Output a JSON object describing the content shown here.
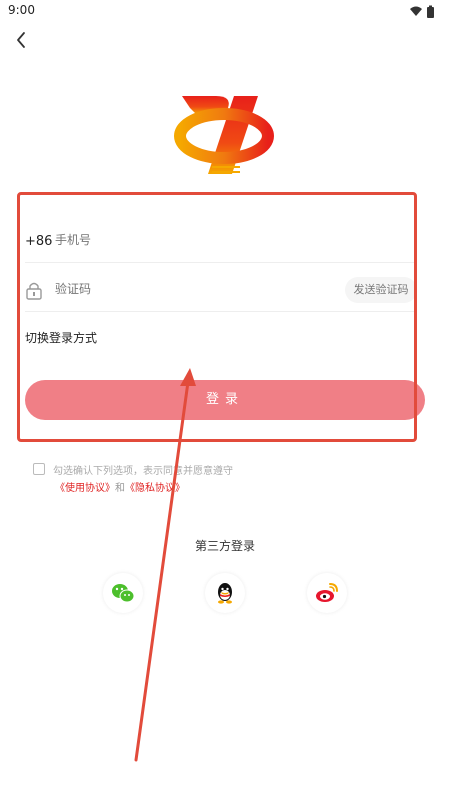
{
  "status": {
    "time": "9:00"
  },
  "login_form": {
    "phone_prefix": "+86",
    "phone_placeholder": "手机号",
    "code_placeholder": "验证码",
    "send_code_label": "发送验证码",
    "switch_method_label": "切换登录方式",
    "login_button_label": "登录"
  },
  "agreement": {
    "text": "勾选确认下列选项，表示同意并愿意遵守",
    "terms_link": "《使用协议》",
    "and_text": "和",
    "privacy_link": "《隐私协议》"
  },
  "third_party": {
    "title": "第三方登录",
    "providers": [
      "wechat-icon",
      "qq-icon",
      "weibo-icon"
    ]
  },
  "colors": {
    "login_button": "#f07f86",
    "link_red": "#e02424",
    "annotation_red": "#e24b3b",
    "logo_red": "#e8201a",
    "logo_yellow": "#f5a800"
  }
}
